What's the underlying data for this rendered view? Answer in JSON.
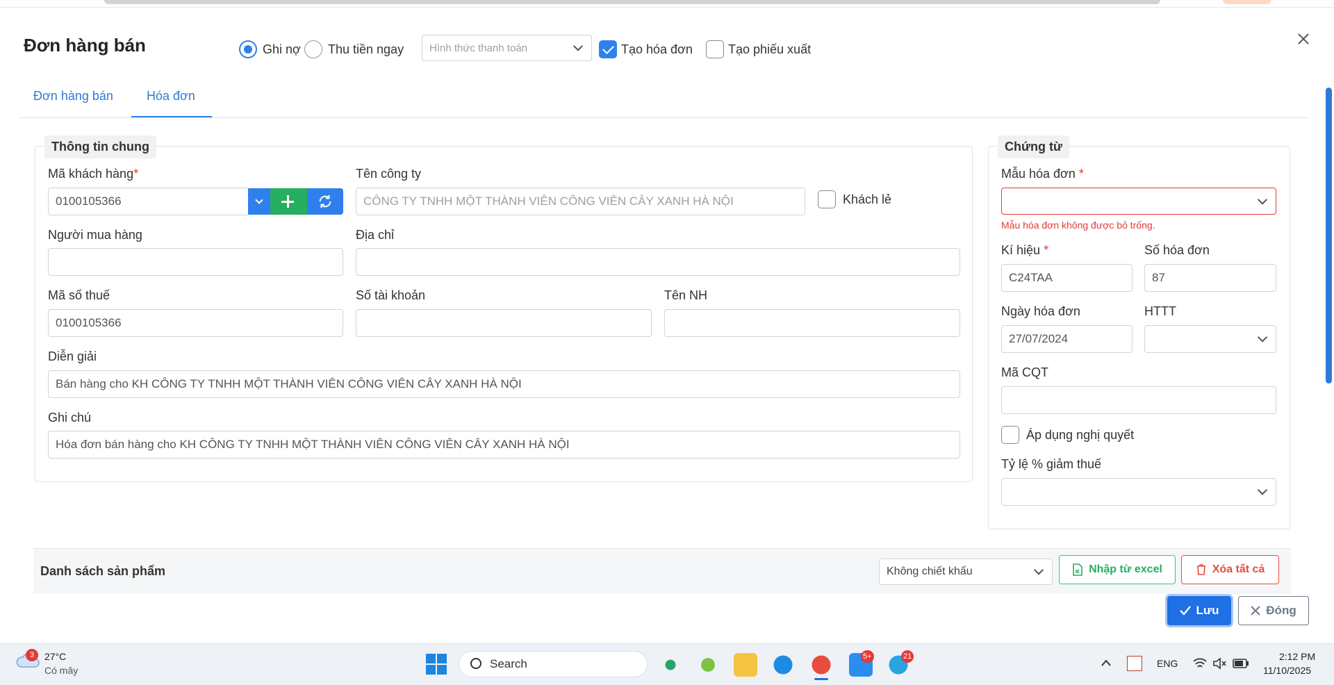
{
  "header": {
    "title": "Đơn hàng bán",
    "radio_debt": "Ghi nợ",
    "radio_cash": "Thu tiền ngay",
    "payment_method_placeholder": "Hình thức thanh toán",
    "create_invoice": "Tạo hóa đơn",
    "create_export": "Tạo phiếu xuất"
  },
  "tabs": [
    {
      "label": "Đơn hàng bán"
    },
    {
      "label": "Hóa đơn"
    }
  ],
  "general": {
    "legend": "Thông tin chung",
    "customer_code_label": "Mã khách hàng",
    "customer_code_value": "0100105366",
    "company_label": "Tên công ty",
    "company_value": "CÔNG TY TNHH MỘT THÀNH VIÊN CÔNG VIÊN CÂY XANH HÀ NỘI",
    "retail_label": "Khách lẻ",
    "buyer_label": "Người mua hàng",
    "address_label": "Địa chỉ",
    "tax_code_label": "Mã số thuế",
    "tax_code_value": "0100105366",
    "account_label": "Số tài khoản",
    "bank_label": "Tên NH",
    "description_label": "Diễn giải",
    "description_value": "Bán hàng cho KH CÔNG TY TNHH MỘT THÀNH VIÊN CÔNG VIÊN CÂY XANH HÀ NỘI",
    "note_label": "Ghi chú",
    "note_value": "Hóa đơn bán hàng cho KH CÔNG TY TNHH MỘT THÀNH VIÊN CÔNG VIÊN CÂY XANH HÀ NỘI"
  },
  "voucher": {
    "legend": "Chứng từ",
    "template_label": "Mẫu hóa đơn",
    "template_error": "Mẫu hóa đơn không được bỏ trống.",
    "symbol_label": "Kí hiệu",
    "symbol_value": "C24TAA",
    "invoice_no_label": "Số hóa đơn",
    "invoice_no_value": "87",
    "invoice_date_label": "Ngày hóa đơn",
    "invoice_date_value": "27/07/2024",
    "payment_label": "HTTT",
    "tax_auth_label": "Mã CQT",
    "resolution_label": "Áp dụng nghị quyết",
    "tax_reduce_label": "Tỷ lệ % giảm thuế"
  },
  "products": {
    "title": "Danh sách sản phẩm",
    "discount_value": "Không chiết khấu",
    "import_excel": "Nhập từ excel",
    "delete_all": "Xóa tất cả"
  },
  "footer": {
    "save": "Lưu",
    "close": "Đóng"
  },
  "taskbar": {
    "weather_temp": "27°C",
    "weather_desc": "Có mây",
    "weather_badge": "3",
    "search": "Search",
    "lang": "ENG",
    "time": "2:12 PM",
    "date": "11/10/2025",
    "zalo_badge": "5+",
    "telegram_badge": "21"
  },
  "colors": {
    "accent": "#2f80ed",
    "success": "#27ae60",
    "danger": "#e74c3c"
  }
}
